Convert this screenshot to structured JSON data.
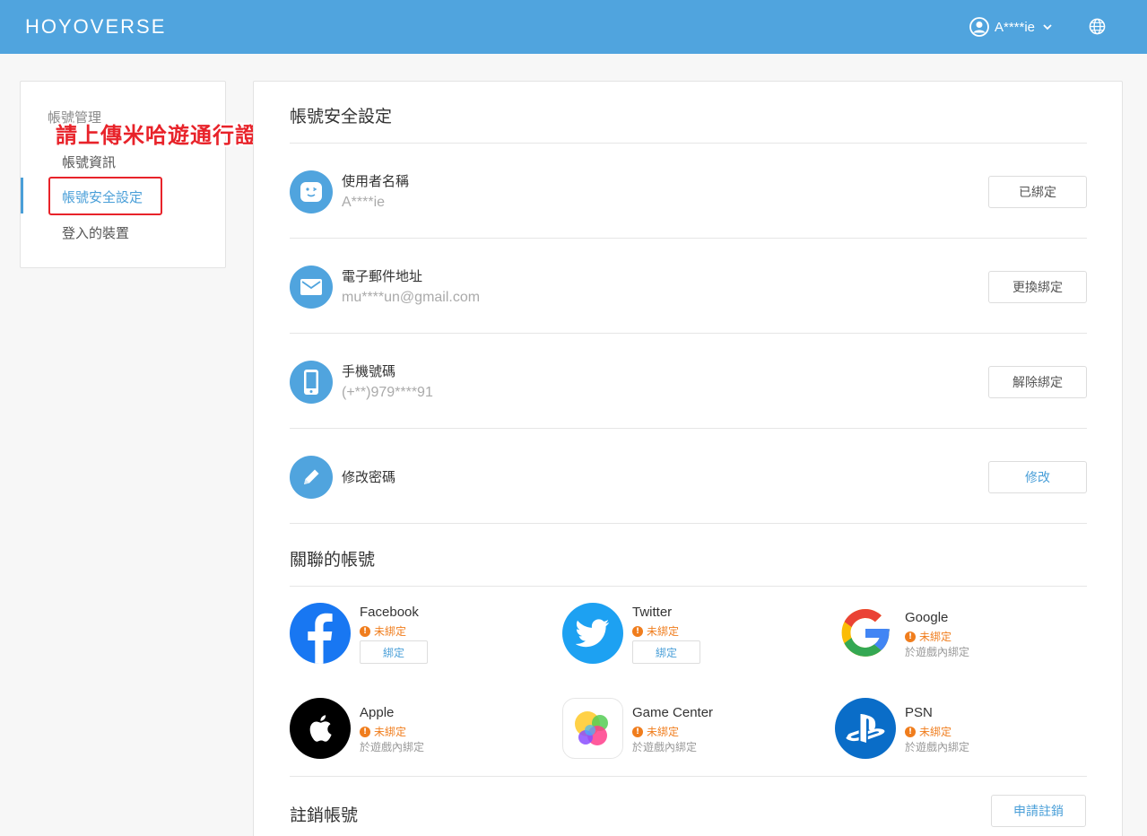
{
  "header": {
    "logo": "HOYOVERSE",
    "username": "A****ie"
  },
  "sidebar": {
    "title": "帳號管理",
    "items": [
      {
        "label": "帳號資訊"
      },
      {
        "label": "帳號安全設定"
      },
      {
        "label": "登入的裝置"
      }
    ]
  },
  "annotation": {
    "text": "請上傳米哈遊通行證【帳號安全設定】頁面截圖",
    "color": "#e8232a"
  },
  "main": {
    "title": "帳號安全設定",
    "rows": [
      {
        "label": "使用者名稱",
        "value": "A****ie",
        "button": "已綁定",
        "icon": "face-icon"
      },
      {
        "label": "電子郵件地址",
        "value": "mu****un@gmail.com",
        "button": "更換綁定",
        "icon": "mail-icon"
      },
      {
        "label": "手機號碼",
        "value": "(+**)979****91",
        "button": "解除綁定",
        "icon": "phone-icon"
      },
      {
        "label": "修改密碼",
        "button": "修改",
        "icon": "pencil-icon"
      }
    ],
    "linked": {
      "title": "關聯的帳號",
      "accounts": [
        {
          "name": "Facebook",
          "status": "未綁定",
          "button": "綁定",
          "icon": "facebook-icon"
        },
        {
          "name": "Twitter",
          "status": "未綁定",
          "button": "綁定",
          "icon": "twitter-icon"
        },
        {
          "name": "Google",
          "status": "未綁定",
          "note": "於遊戲內綁定",
          "icon": "google-icon"
        },
        {
          "name": "Apple",
          "status": "未綁定",
          "note": "於遊戲內綁定",
          "icon": "apple-icon"
        },
        {
          "name": "Game Center",
          "status": "未綁定",
          "note": "於遊戲內綁定",
          "icon": "game-center-icon"
        },
        {
          "name": "PSN",
          "status": "未綁定",
          "note": "於遊戲內綁定",
          "icon": "playstation-icon"
        }
      ]
    },
    "deactivate": {
      "title": "註銷帳號",
      "button": "申請註銷"
    }
  },
  "colors": {
    "header": "#50a4de",
    "accent": "#4a9fd8",
    "warning": "#f07d1d"
  }
}
